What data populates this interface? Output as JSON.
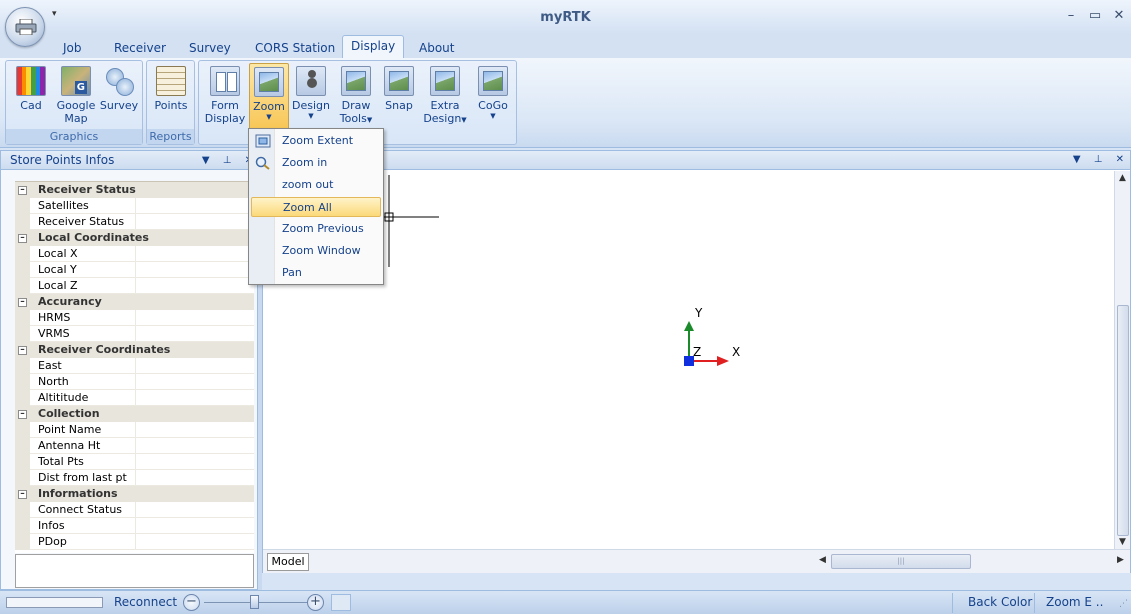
{
  "window": {
    "title": "myRTK",
    "qat_arrow": "▾",
    "minimize": "–",
    "maximize": "▭",
    "close": "✕"
  },
  "tabs": [
    "Job",
    "Receiver",
    "Survey",
    "CORS Station",
    "Display",
    "About"
  ],
  "active_tab": "Display",
  "ribbon": {
    "groups": [
      {
        "label": "Graphics",
        "buttons": [
          {
            "label_line1": "Cad",
            "label_line2": "",
            "icon": "cad-palette-icon"
          },
          {
            "label_line1": "Google",
            "label_line2": "Map",
            "icon": "google-map-icon"
          },
          {
            "label_line1": "Survey",
            "label_line2": "",
            "icon": "survey-bubbles-icon"
          }
        ]
      },
      {
        "label": "Reports",
        "buttons": [
          {
            "label_line1": "Points",
            "label_line2": "",
            "icon": "points-report-icon"
          }
        ]
      },
      {
        "label": "",
        "buttons": [
          {
            "label_line1": "Form",
            "label_line2": "Display",
            "icon": "form-display-icon"
          },
          {
            "label_line1": "Zoom",
            "label_line2": "",
            "icon": "zoom-picture-icon",
            "dropdown": true,
            "pressed": true
          },
          {
            "label_line1": "Design",
            "label_line2": "",
            "icon": "design-person-icon",
            "dropdown": true
          },
          {
            "label_line1": "Draw",
            "label_line2": "Tools",
            "icon": "draw-tools-picture-icon",
            "dropdown": true
          },
          {
            "label_line1": "Snap",
            "label_line2": "",
            "icon": "snap-picture-icon"
          },
          {
            "label_line1": "Extra",
            "label_line2": "Design",
            "icon": "extra-design-picture-icon",
            "dropdown": true
          },
          {
            "label_line1": "CoGo",
            "label_line2": "",
            "icon": "cogo-picture-icon",
            "dropdown": true
          }
        ]
      }
    ]
  },
  "zoom_menu": {
    "items": [
      {
        "label": "Zoom Extent",
        "icon": "zoom-extent-icon",
        "highlighted": false
      },
      {
        "label": "Zoom in",
        "icon": "magnifier-icon",
        "highlighted": false
      },
      {
        "label": "zoom out",
        "icon": "",
        "highlighted": false
      },
      {
        "label": "Zoom All",
        "icon": "",
        "highlighted": true
      },
      {
        "label": "Zoom Previous",
        "icon": "",
        "highlighted": false
      },
      {
        "label": "Zoom Window",
        "icon": "",
        "highlighted": false
      },
      {
        "label": "Pan",
        "icon": "",
        "highlighted": false
      }
    ]
  },
  "left_panel": {
    "title": "Store Points Infos",
    "header_buttons": {
      "dropdown": "▼",
      "pin": "⊥",
      "close": "✕"
    },
    "categories": [
      {
        "name": "Receiver Status",
        "rows": [
          "Satellites",
          "Receiver Status"
        ]
      },
      {
        "name": "Local Coordinates",
        "rows": [
          "Local X",
          "Local Y",
          "Local Z"
        ]
      },
      {
        "name": "Accurancy",
        "rows": [
          "HRMS",
          "VRMS"
        ]
      },
      {
        "name": "Receiver Coordinates",
        "rows": [
          "East",
          "North",
          "Altititude"
        ]
      },
      {
        "name": "Collection",
        "rows": [
          "Point Name",
          "Antenna Ht",
          "Total Pts",
          "Dist from last pt"
        ]
      },
      {
        "name": "Informations",
        "rows": [
          "Connect Status",
          "Infos",
          "PDop"
        ]
      }
    ],
    "collapse_glyph": "–"
  },
  "document": {
    "header_buttons": {
      "dropdown": "▼",
      "pin": "⊥",
      "close": "✕"
    },
    "model_tab": "Model",
    "axes": {
      "y_label": "Y",
      "z_label": "Z",
      "x_label": "X"
    },
    "scroll_up": "▲",
    "scroll_down": "▼",
    "scroll_left": "◀",
    "scroll_right": "▶",
    "thumb_grip": "|||"
  },
  "statusbar": {
    "reconnect": "Reconnect",
    "zoom_minus": "−",
    "zoom_plus": "+",
    "back_color": "Back Color",
    "zoom_status": "Zoom E ..",
    "grip": "⋰"
  }
}
